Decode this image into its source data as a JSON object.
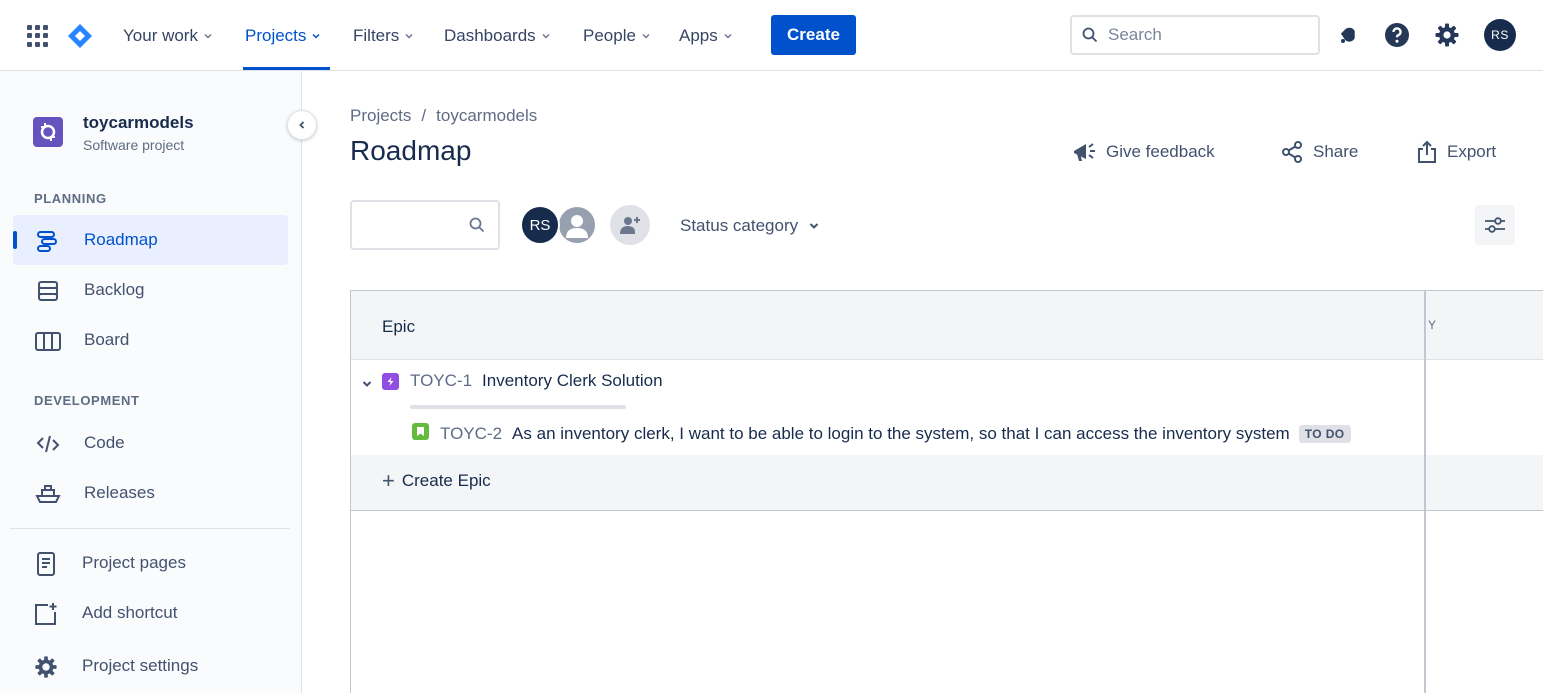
{
  "topnav": {
    "items": [
      {
        "label": "Your work"
      },
      {
        "label": "Projects"
      },
      {
        "label": "Filters"
      },
      {
        "label": "Dashboards"
      },
      {
        "label": "People"
      },
      {
        "label": "Apps"
      }
    ],
    "active_index": 1,
    "create_label": "Create",
    "search_placeholder": "Search",
    "user_initials": "RS",
    "icons": [
      "apps-grid-icon",
      "jira-logo",
      "notifications-icon",
      "help-icon",
      "settings-icon"
    ]
  },
  "sidebar": {
    "project_name": "toycarmodels",
    "project_type": "Software project",
    "planning_label": "PLANNING",
    "development_label": "DEVELOPMENT",
    "planning_items": [
      {
        "label": "Roadmap",
        "icon": "roadmap-icon",
        "active": true
      },
      {
        "label": "Backlog",
        "icon": "backlog-icon"
      },
      {
        "label": "Board",
        "icon": "board-icon"
      }
    ],
    "development_items": [
      {
        "label": "Code",
        "icon": "code-icon"
      },
      {
        "label": "Releases",
        "icon": "releases-icon"
      }
    ],
    "footer_items": [
      {
        "label": "Project pages",
        "icon": "page-icon"
      },
      {
        "label": "Add shortcut",
        "icon": "add-shortcut-icon"
      },
      {
        "label": "Project settings",
        "icon": "settings-icon"
      }
    ]
  },
  "header": {
    "breadcrumb": [
      "Projects",
      "toycarmodels"
    ],
    "breadcrumb_sep": "/",
    "title": "Roadmap",
    "actions": {
      "feedback": "Give feedback",
      "share": "Share",
      "export": "Export"
    }
  },
  "filters": {
    "search_value": "",
    "avatars": [
      {
        "initials": "RS",
        "color": "#172b4d"
      },
      {
        "initials": "",
        "color": "#97a0af"
      }
    ],
    "status_category": "Status category"
  },
  "roadmap": {
    "column_header": "Epic",
    "truncated_header": "Y",
    "epics": [
      {
        "key": "TOYC-1",
        "summary": "Inventory Clerk Solution",
        "progress": 0,
        "children": [
          {
            "key": "TOYC-2",
            "summary": "As an inventory clerk, I want to be able to login to the system, so that I can access the inventory system",
            "status": "TO DO"
          }
        ]
      }
    ],
    "create_epic_label": "Create Epic"
  },
  "colors": {
    "accent": "#0052cc",
    "epic": "#904ee2",
    "story": "#63ba3c",
    "text": "#172b4d"
  }
}
